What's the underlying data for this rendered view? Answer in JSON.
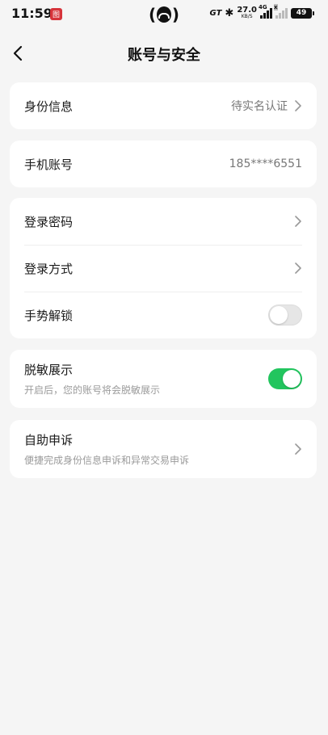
{
  "status_bar": {
    "time": "11:59",
    "app_badge": "图",
    "network_brand": "GT",
    "speed_value": "27.0",
    "speed_unit": "KB/S",
    "signal_tag": "4G",
    "signal_tag2": "x",
    "battery": "49"
  },
  "nav": {
    "title": "账号与安全"
  },
  "identity": {
    "label": "身份信息",
    "value": "待实名认证"
  },
  "phone": {
    "label": "手机账号",
    "value": "185****6551"
  },
  "security": {
    "login_password": "登录密码",
    "login_method": "登录方式",
    "gesture_unlock": "手势解锁",
    "gesture_enabled": false
  },
  "masking": {
    "label": "脱敏展示",
    "desc": "开启后，您的账号将会脱敏展示",
    "enabled": true,
    "accent": "#22c55e"
  },
  "appeal": {
    "label": "自助申诉",
    "desc": "便捷完成身份信息申诉和异常交易申诉"
  }
}
